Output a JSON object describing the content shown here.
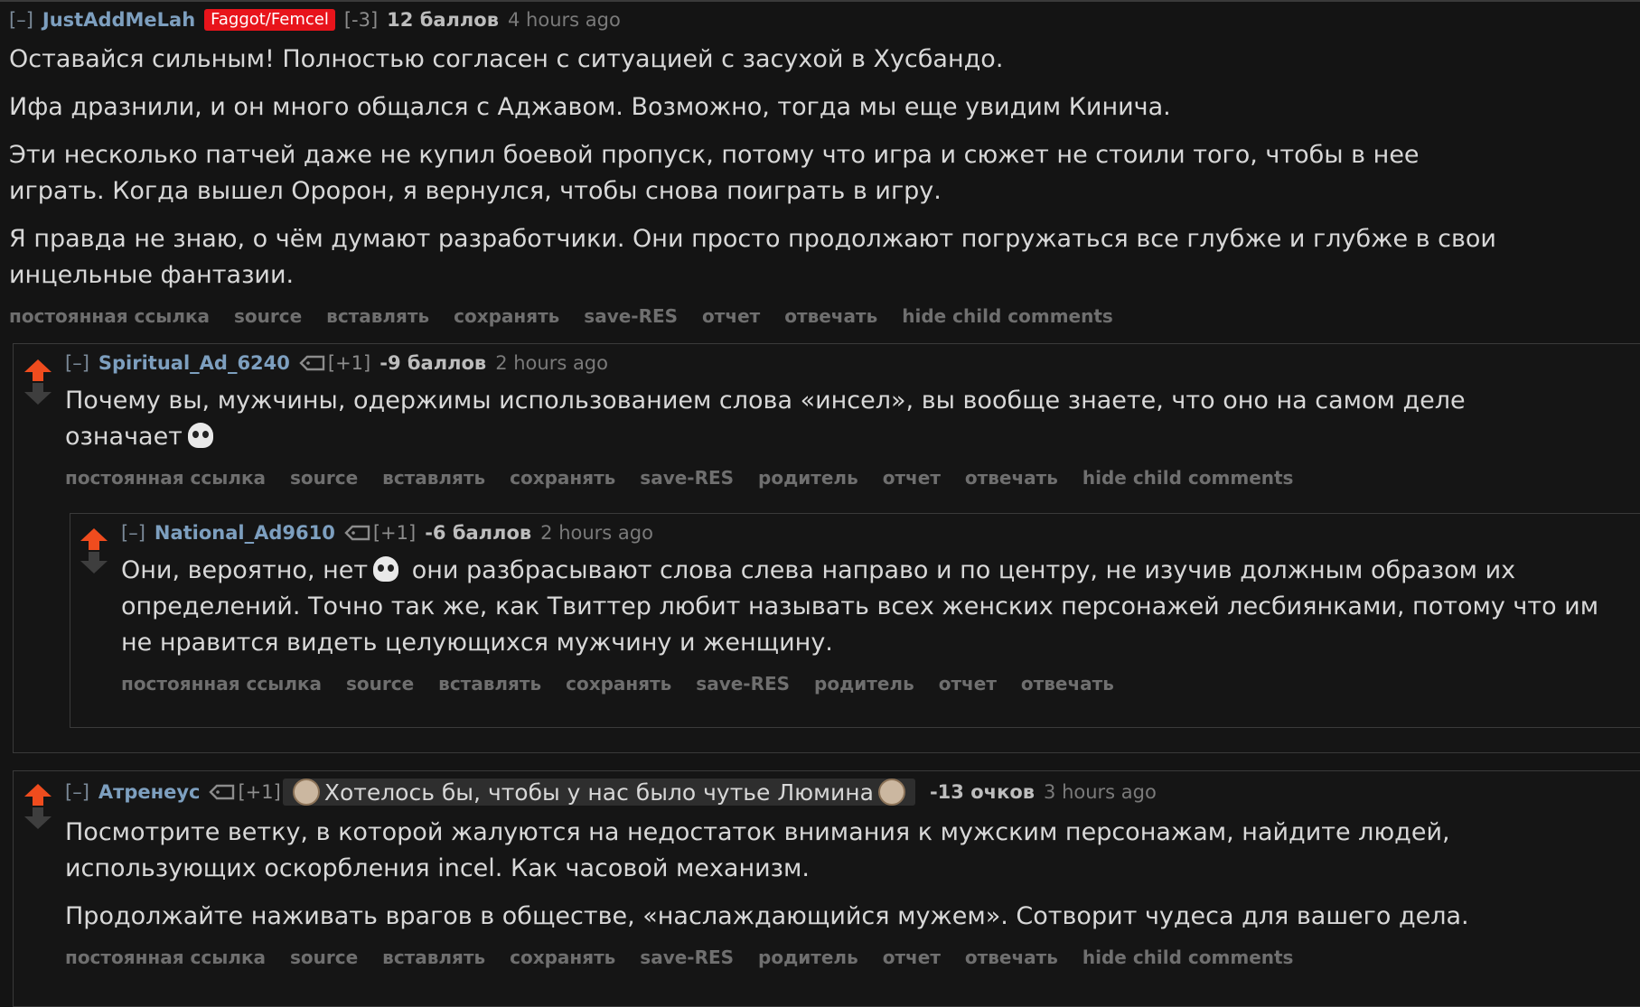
{
  "c1": {
    "collapse": "[–]",
    "author": "JustAddMeLah",
    "flair": "Faggot/Femcel",
    "vote": "[-3]",
    "score": "12 баллов",
    "time": "4 hours ago",
    "paragraphs": [
      "Оставайся сильным! Полностью согласен с ситуацией с засухой в Хусбандо.",
      "Ифа дразнили, и он много общался с Аджавом. Возможно, тогда мы еще увидим Кинича.",
      "Эти несколько патчей даже не купил боевой пропуск, потому что игра и сюжет не стоили того, чтобы в нее играть. Когда вышел Оророн, я вернулся, чтобы снова поиграть в игру.",
      "Я правда не знаю, о чём думают разработчики. Они просто продолжают погружаться все глубже и глубже в свои инцельные фантазии."
    ],
    "buttons": [
      "постоянная ссылка",
      "source",
      "вставлять",
      "сохранять",
      "save-RES",
      "отчет",
      "отвечать",
      "hide child comments"
    ]
  },
  "c2": {
    "collapse": "[–]",
    "author": "Spiritual_Ad_6240",
    "vote": "[+1]",
    "score": "-9 баллов",
    "time": "2 hours ago",
    "text_a": "Почему вы, мужчины, одержимы использованием слова «инсел», вы вообще знаете, что оно на самом деле",
    "text_b": "означает",
    "buttons": [
      "постоянная ссылка",
      "source",
      "вставлять",
      "сохранять",
      "save-RES",
      "родитель",
      "отчет",
      "отвечать",
      "hide child comments"
    ]
  },
  "c3": {
    "collapse": "[–]",
    "author": "National_Ad9610",
    "vote": "[+1]",
    "score": "-6 баллов",
    "time": "2 hours ago",
    "text_a": "Они, вероятно, нет",
    "text_b": "они разбрасывают слова слева направо и по центру, не изучив должным образом их определений. Точно так же, как Твиттер любит называть всех женских персонажей лесбиянками, потому что им не нравится видеть целующихся мужчину и женщину.",
    "buttons": [
      "постоянная ссылка",
      "source",
      "вставлять",
      "сохранять",
      "save-RES",
      "родитель",
      "отчет",
      "отвечать"
    ]
  },
  "c4": {
    "collapse": "[–]",
    "author": "Атренеус",
    "vote": "[+1]",
    "flair": "Хотелось бы, чтобы у нас было чутье Люмина",
    "score": "-13 очков",
    "time": "3 hours ago",
    "paragraphs": [
      "Посмотрите ветку, в которой жалуются на недостаток внимания к мужским персонажам, найдите людей, использующих оскорбления incel. Как часовой механизм.",
      "Продолжайте наживать врагов в обществе, «наслаждающийся мужем». Сотворит чудеса для вашего дела."
    ],
    "buttons": [
      "постоянная ссылка",
      "source",
      "вставлять",
      "сохранять",
      "save-RES",
      "родитель",
      "отчет",
      "отвечать",
      "hide child comments"
    ]
  }
}
